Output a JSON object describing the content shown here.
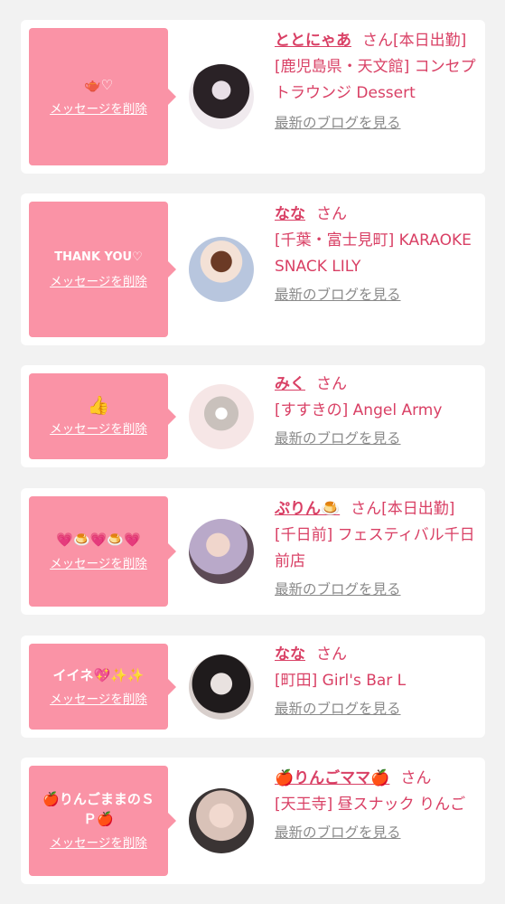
{
  "messages": [
    {
      "message_text": "🫖♡",
      "delete_label": "メッセージを削除",
      "name": "ととにゃあ",
      "honorific": "さん",
      "status": "[本日出勤]",
      "store": "[鹿児島県・天文館] コンセプトラウンジ Dessert",
      "blog_label": "最新のブログを見る"
    },
    {
      "message_text": "THANK YOU♡",
      "delete_label": "メッセージを削除",
      "name": "なな",
      "honorific": "さん",
      "status": "",
      "store": "[千葉・富士見町] KARAOKE SNACK LILY",
      "blog_label": "最新のブログを見る"
    },
    {
      "message_text": "👍",
      "delete_label": "メッセージを削除",
      "name": "みく",
      "honorific": "さん",
      "status": "",
      "store": "[すすきの] Angel Army",
      "blog_label": "最新のブログを見る"
    },
    {
      "message_text": "💗🍮💗🍮💗",
      "delete_label": "メッセージを削除",
      "name": "ぷりん🍮",
      "honorific": "さん",
      "status": "[本日出勤]",
      "store": "[千日前] フェスティバル千日前店",
      "blog_label": "最新のブログを見る"
    },
    {
      "message_text": "イイネ💖✨✨",
      "delete_label": "メッセージを削除",
      "name": "なな",
      "honorific": "さん",
      "status": "",
      "store": "[町田] Girl's Bar L",
      "blog_label": "最新のブログを見る"
    },
    {
      "message_text": "🍎りんごままのＳＰ🍎",
      "delete_label": "メッセージを削除",
      "name": "🍎りんごママ🍎",
      "honorific": "さん",
      "status": "",
      "store": "[天王寺] 昼スナック りんご",
      "blog_label": "最新のブログを見る"
    }
  ]
}
